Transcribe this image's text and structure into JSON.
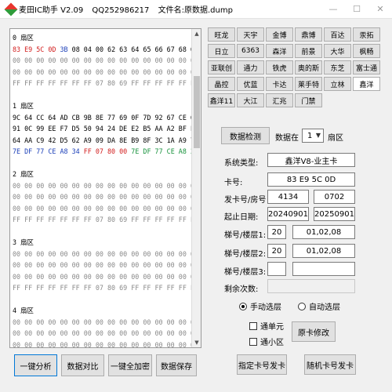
{
  "window": {
    "app_name": "麦田IC助手 V2.09",
    "qq": "QQ252986217",
    "file_label": "文件名:原数据.dump",
    "minimize_icon": "—",
    "maximize_icon": "☐",
    "close_icon": "✕"
  },
  "hex": {
    "lines": [
      {
        "cls": "head c-black",
        "text": "0 扇区"
      },
      {
        "cls": "",
        "segments": [
          {
            "c": "c-red",
            "t": "83 E9 5C 0D "
          },
          {
            "c": "c-blue",
            "t": "3B "
          },
          {
            "c": "c-black",
            "t": "08 04 00 62 63 64 65 66 67 68 69"
          }
        ]
      },
      {
        "cls": "c-gray",
        "text": "00 00 00 00 00 00 00 00 00 00 00 00 00 00 00 00"
      },
      {
        "cls": "c-gray",
        "text": "00 00 00 00 00 00 00 00 00 00 00 00 00 00 00 00"
      },
      {
        "cls": "c-gray",
        "text": "FF FF FF FF FF FF FF 07 80 69 FF FF FF FF FF FF"
      },
      {
        "cls": "",
        "text": " "
      },
      {
        "cls": "head c-black",
        "text": "1 扇区"
      },
      {
        "cls": "c-black",
        "text": "9C 64 CC 64 AD CB 9B 8E 77 69 0F 7D 92 67 CE 64"
      },
      {
        "cls": "c-black",
        "text": "91 0C 99 EE F7 D5 50 94 24 DE E2 B5 AA A2 BF F0"
      },
      {
        "cls": "c-black",
        "text": "64 AA C9 42 D5 62 A9 09 DA 8E B9 8F 3C 1A A9 7B"
      },
      {
        "cls": "",
        "segments": [
          {
            "c": "c-blue",
            "t": "7E DF 77 CE A8 34 "
          },
          {
            "c": "c-red",
            "t": "FF 07 80 00 "
          },
          {
            "c": "c-green",
            "t": "7E DF 77 CE A8 34"
          }
        ]
      },
      {
        "cls": "",
        "text": " "
      },
      {
        "cls": "head c-gray",
        "text": "2 扇区"
      },
      {
        "cls": "c-gray",
        "text": "00 00 00 00 00 00 00 00 00 00 00 00 00 00 00 00"
      },
      {
        "cls": "c-gray",
        "text": "00 00 00 00 00 00 00 00 00 00 00 00 00 00 00 00"
      },
      {
        "cls": "c-gray",
        "text": "00 00 00 00 00 00 00 00 00 00 00 00 00 00 00 00"
      },
      {
        "cls": "c-gray",
        "text": "FF FF FF FF FF FF FF 07 80 69 FF FF FF FF FF FF"
      },
      {
        "cls": "",
        "text": " "
      },
      {
        "cls": "head c-gray",
        "text": "3 扇区"
      },
      {
        "cls": "c-gray",
        "text": "00 00 00 00 00 00 00 00 00 00 00 00 00 00 00 00"
      },
      {
        "cls": "c-gray",
        "text": "00 00 00 00 00 00 00 00 00 00 00 00 00 00 00 00"
      },
      {
        "cls": "c-gray",
        "text": "00 00 00 00 00 00 00 00 00 00 00 00 00 00 00 00"
      },
      {
        "cls": "c-gray",
        "text": "FF FF FF FF FF FF FF 07 80 69 FF FF FF FF FF FF"
      },
      {
        "cls": "",
        "text": " "
      },
      {
        "cls": "head c-gray",
        "text": "4 扇区"
      },
      {
        "cls": "c-gray",
        "text": "00 00 00 00 00 00 00 00 00 00 00 00 00 00 00 00"
      },
      {
        "cls": "c-gray",
        "text": "00 00 00 00 00 00 00 00 00 00 00 00 00 00 00 00"
      },
      {
        "cls": "c-gray",
        "text": "00 00 00 00 00 00 00 00 00 00 00 00 00 00 00 00"
      }
    ],
    "scroll_up": "▲",
    "scroll_down": "▼"
  },
  "bottom_buttons": {
    "analyze": "一键分析",
    "compare": "数据对比",
    "encrypt_all": "一键全加密",
    "save": "数据保存"
  },
  "companies": [
    [
      "旺龙",
      "天宇",
      "金博",
      "鼎博",
      "百达",
      "汞拓"
    ],
    [
      "日立",
      "6363",
      "森洋",
      "前景",
      "大华",
      "枫畅"
    ],
    [
      "亚联创",
      "通力",
      "铁虎",
      "奥的斯",
      "东芝",
      "富士通"
    ],
    [
      "晶控",
      "优蓝",
      "卡达",
      "莱手特",
      "立林",
      "鑫洋"
    ],
    [
      "鑫洋11",
      "大江",
      "汇兆",
      "门禁"
    ]
  ],
  "detect": {
    "button": "数据检测",
    "data_in": "数据在",
    "sector_value": "1",
    "sector_suffix": "扇区"
  },
  "form": {
    "system_type_label": "系统类型:",
    "system_type_value": "鑫洋V8-业主卡",
    "card_no_label": "卡号:",
    "card_no_value": "83 E9 5C 0D",
    "issue_label": "发卡号/房号",
    "issue_value": "4134",
    "room_value": "0702",
    "date_label": "起止日期:",
    "start_date": "20240901",
    "end_date": "20250901",
    "floor1_label": "梯号/楼层1:",
    "floor1_ladder": "20",
    "floor1_floors": "01,02,08",
    "floor2_label": "梯号/楼层2:",
    "floor2_ladder": "20",
    "floor2_floors": "01,02,08",
    "floor3_label": "梯号/楼层3:",
    "floor3_ladder": "",
    "floor3_floors": "",
    "remaining_label": "剩余次数:",
    "remaining_value": ""
  },
  "options": {
    "manual": "手动选层",
    "auto": "自动选层",
    "pass_unit": "通单元",
    "pass_area": "通小区",
    "modify_card": "原卡修改",
    "issue_specified": "指定卡号发卡",
    "issue_random": "随机卡号发卡"
  }
}
